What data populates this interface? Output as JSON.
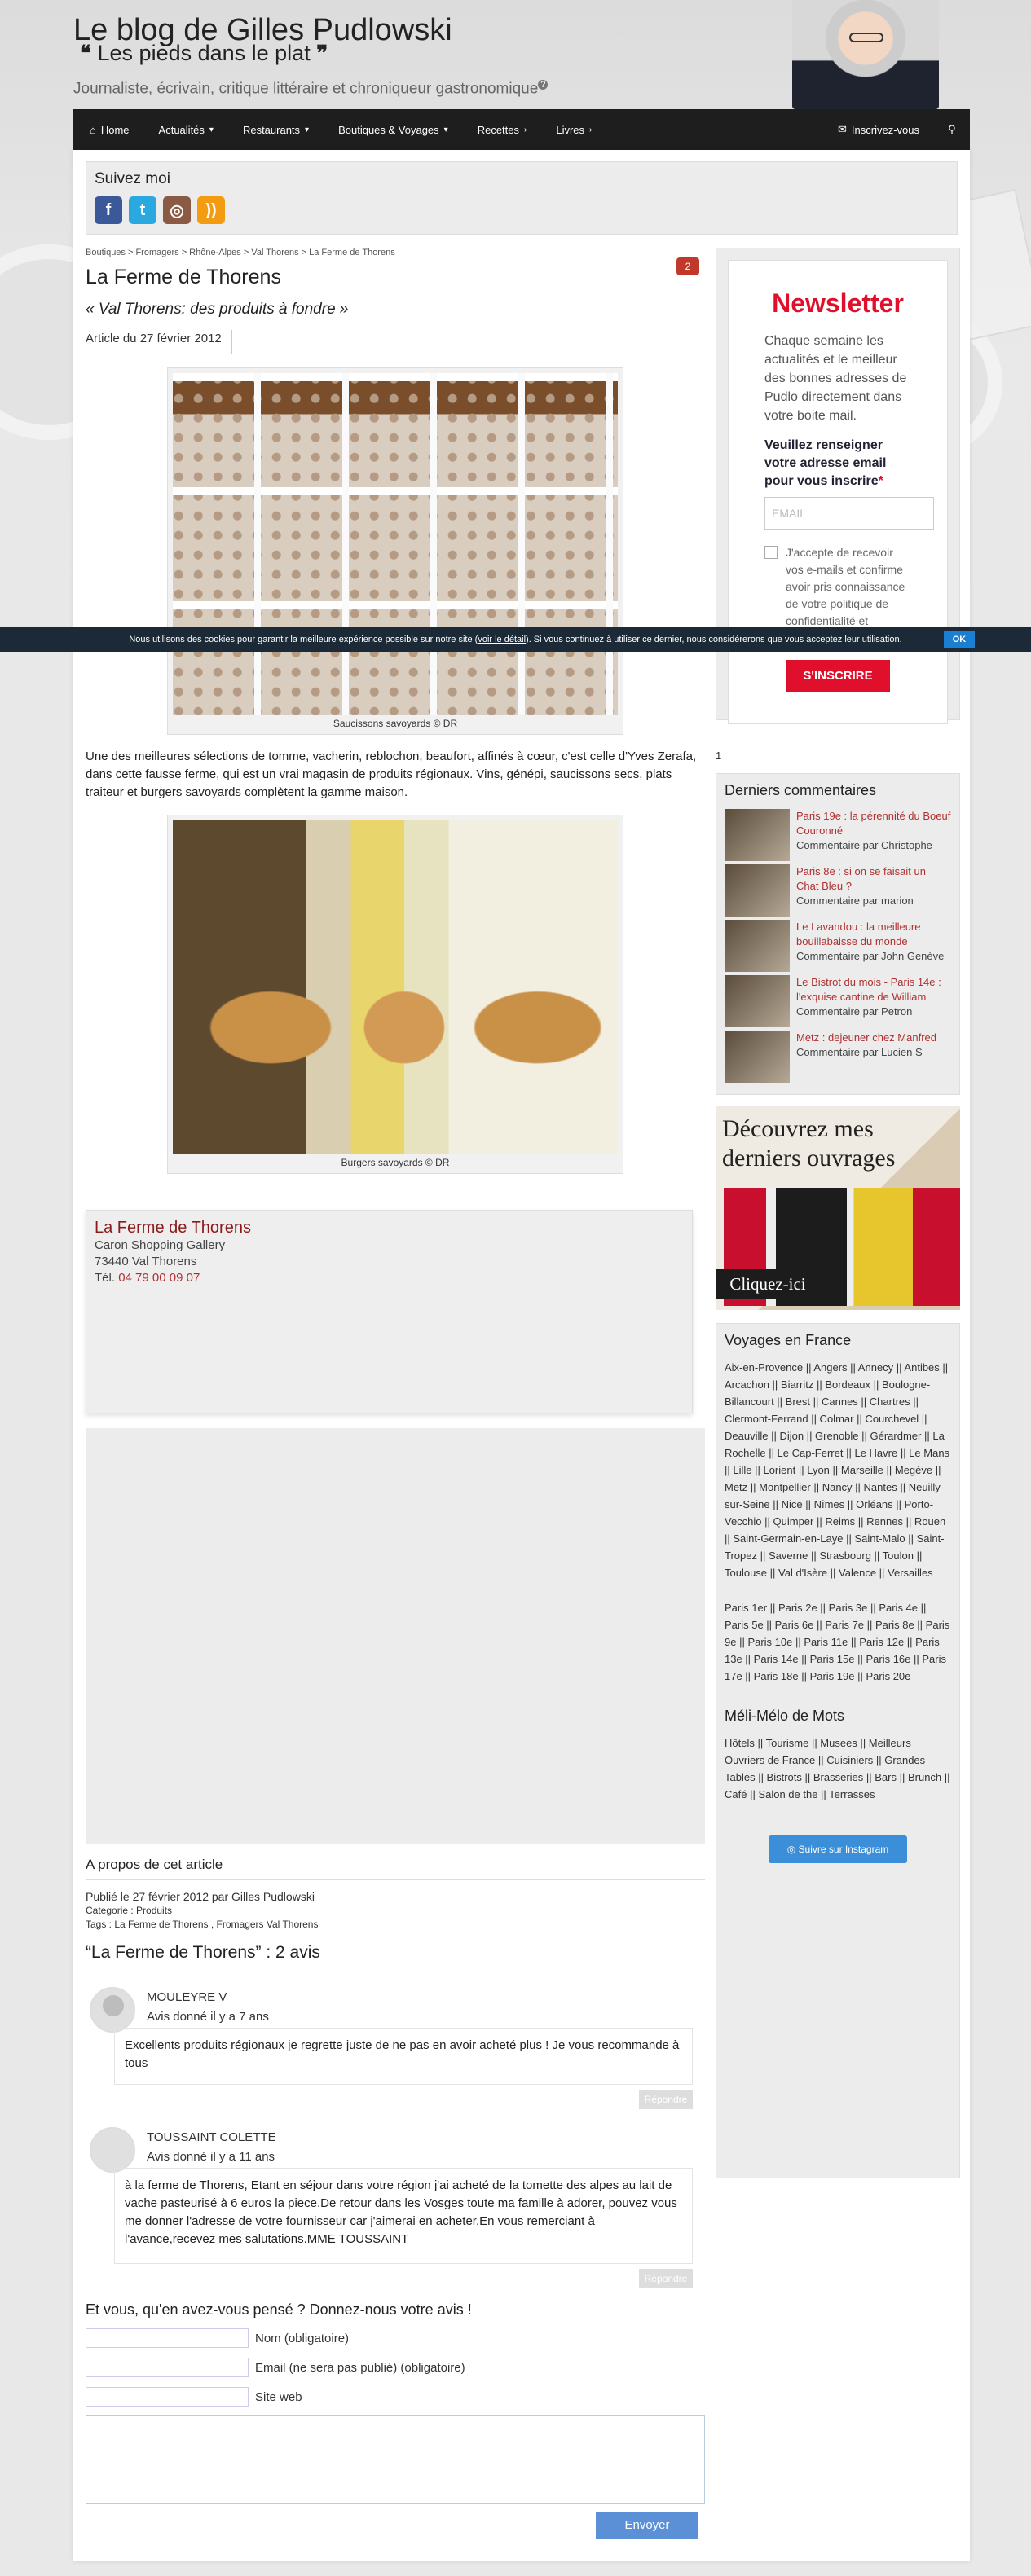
{
  "site": {
    "title": "Le blog de Gilles Pudlowski",
    "tagline_quote_open": "❝",
    "tagline": "Les pieds dans le plat",
    "tagline_quote_close": "❞",
    "subline": "Journaliste, écrivain, critique littéraire et chroniqueur gastronomique",
    "subline_badge": "?"
  },
  "nav": {
    "items": [
      {
        "label": "Home",
        "icon": "home-icon"
      },
      {
        "label": "Actualités",
        "caret": "▾"
      },
      {
        "label": "Restaurants",
        "caret": "▾"
      },
      {
        "label": "Boutiques & Voyages",
        "caret": "▾"
      },
      {
        "label": "Recettes",
        "caret": "›"
      },
      {
        "label": "Livres",
        "caret": "›"
      }
    ],
    "subscribe": "Inscrivez-vous",
    "search_icon": "search-icon"
  },
  "follow": {
    "title": "Suivez moi",
    "networks": [
      {
        "name": "facebook-icon",
        "glyph": "f"
      },
      {
        "name": "twitter-icon",
        "glyph": "t"
      },
      {
        "name": "instagram-icon",
        "glyph": "◎"
      },
      {
        "name": "rss-icon",
        "glyph": "))"
      }
    ]
  },
  "article": {
    "breadcrumb": "Boutiques > Fromagers > Rhône-Alpes > Val Thorens > La Ferme de Thorens",
    "title": "La Ferme de Thorens",
    "comment_count": "2",
    "subtitle": "« Val Thorens: des produits à fondre »",
    "date": "Article du 27 février 2012",
    "caption1": "Saucissons savoyards © DR",
    "paragraph": "Une des meilleures sélections de tomme, vacherin, reblochon, beaufort, affinés à cœur, c'est celle d'Yves Zerafa, dans cette fausse ferme, qui est un vrai magasin de produits régionaux. Vins, génépi, saucissons secs, plats traiteur et burgers savoyards complètent la gamme maison.",
    "caption2": "Burgers savoyards © DR"
  },
  "contact": {
    "name": "La Ferme de Thorens",
    "address1": "Caron Shopping Gallery",
    "address2": "73440 Val Thorens",
    "tel_label": "Tél.",
    "tel": "04 79 00 09 07"
  },
  "about": {
    "heading": "A propos de cet article",
    "published": "Publié le  27 février 2012 par Gilles Pudlowski",
    "category": "Categorie : Produits",
    "tags": "Tags : La Ferme de Thorens , Fromagers Val Thorens"
  },
  "comments": {
    "title": "“La Ferme de Thorens” : 2 avis",
    "items": [
      {
        "author": "MOULEYRE V",
        "when": "Avis donné il y a 7 ans",
        "text": "Excellents produits régionaux je regrette juste de ne pas en avoir acheté plus ! Je vous recommande à tous",
        "reply": "Répondre"
      },
      {
        "author": "TOUSSAINT COLETTE",
        "when": "Avis donné il y a 11 ans",
        "text": "à la ferme de Thorens, Etant en séjour dans votre région j'ai acheté de la tomette des alpes au lait de vache pasteurisé à 6 euros la piece.De retour dans les Vosges toute ma famille à adorer, pouvez vous me donner l'adresse de votre fournisseur car j'aimerai en acheter.En vous remerciant à l'avance,recevez mes salutations.MME TOUSSAINT",
        "reply": "Répondre"
      }
    ]
  },
  "form": {
    "title": "Et vous, qu'en avez-vous pensé ? Donnez-nous votre avis !",
    "name_label": "Nom (obligatoire)",
    "email_label": "Email (ne sera pas publié) (obligatoire)",
    "site_label": "Site web",
    "submit": "Envoyer"
  },
  "newsletter": {
    "title": "Newsletter",
    "text": "Chaque semaine les actualités et le meilleur des bonnes adresses de Pudlo directement dans votre boite mail.",
    "ask": "Veuillez renseigner votre adresse email pour vous inscrire",
    "ask_star": "*",
    "email_placeholder": "EMAIL",
    "consent": "J'accepte de recevoir vos e-mails et confirme avoir pris connaissance de votre politique de confidentialité et mentions légales.",
    "button": "S'INSCRIRE"
  },
  "sidebar_one": "1",
  "recent": {
    "title": "Derniers commentaires",
    "items": [
      {
        "title": "Paris 19e : la pérennité du Boeuf Couronné",
        "by": "Commentaire par Christophe"
      },
      {
        "title": "Paris 8e : si on se faisait un Chat Bleu ?",
        "by": "Commentaire par marion"
      },
      {
        "title": "Le Lavandou : la meilleure bouillabaisse du monde",
        "by": "Commentaire par John Genève"
      },
      {
        "title": "Le Bistrot du mois - Paris 14e : l'exquise cantine de William",
        "by": "Commentaire par Petron"
      },
      {
        "title": "Metz : dejeuner chez Manfred",
        "by": "Commentaire par Lucien S"
      }
    ]
  },
  "promo": {
    "line1": "Découvrez mes",
    "line2": "derniers ouvrages",
    "cta": "Cliquez-ici"
  },
  "voyages": {
    "title": "Voyages en France",
    "cities": "Aix-en-Provence || Angers || Annecy || Antibes || Arcachon || Biarritz || Bordeaux || Boulogne-Billancourt || Brest || Cannes || Chartres || Clermont-Ferrand || Colmar || Courchevel || Deauville || Dijon || Grenoble || Gérardmer || La Rochelle || Le Cap-Ferret || Le Havre || Le Mans || Lille || Lorient || Lyon || Marseille || Megève || Metz || Montpellier || Nancy || Nantes || Neuilly-sur-Seine || Nice || Nîmes || Orléans || Porto-Vecchio || Quimper || Reims || Rennes || Rouen || Saint-Germain-en-Laye || Saint-Malo || Saint-Tropez || Saverne || Strasbourg || Toulon || Toulouse || Val d'Isère || Valence || Versailles",
    "paris": "Paris 1er || Paris 2e || Paris 3e || Paris 4e || Paris 5e || Paris 6e || Paris 7e || Paris 8e || Paris 9e || Paris 10e || Paris 11e || Paris 12e || Paris 13e || Paris 14e || Paris 15e || Paris 16e || Paris 17e || Paris 18e || Paris 19e || Paris 20e"
  },
  "melimelo": {
    "title": "Méli-Mélo de Mots",
    "text": "Hôtels || Tourisme || Musees || Meilleurs Ouvriers de France || Cuisiniers || Grandes Tables || Bistrots || Brasseries || Bars || Brunch || Café || Salon de the || Terrasses"
  },
  "instagram_button": "Suivre sur Instagram",
  "cookie": {
    "text_before": "Nous utilisons des cookies pour garantir la meilleure expérience possible sur notre site (",
    "link": "voir le détail",
    "text_after": "). Si vous continuez à utiliser ce dernier, nous considérerons que vous acceptez leur utilisation.",
    "ok": "OK"
  }
}
